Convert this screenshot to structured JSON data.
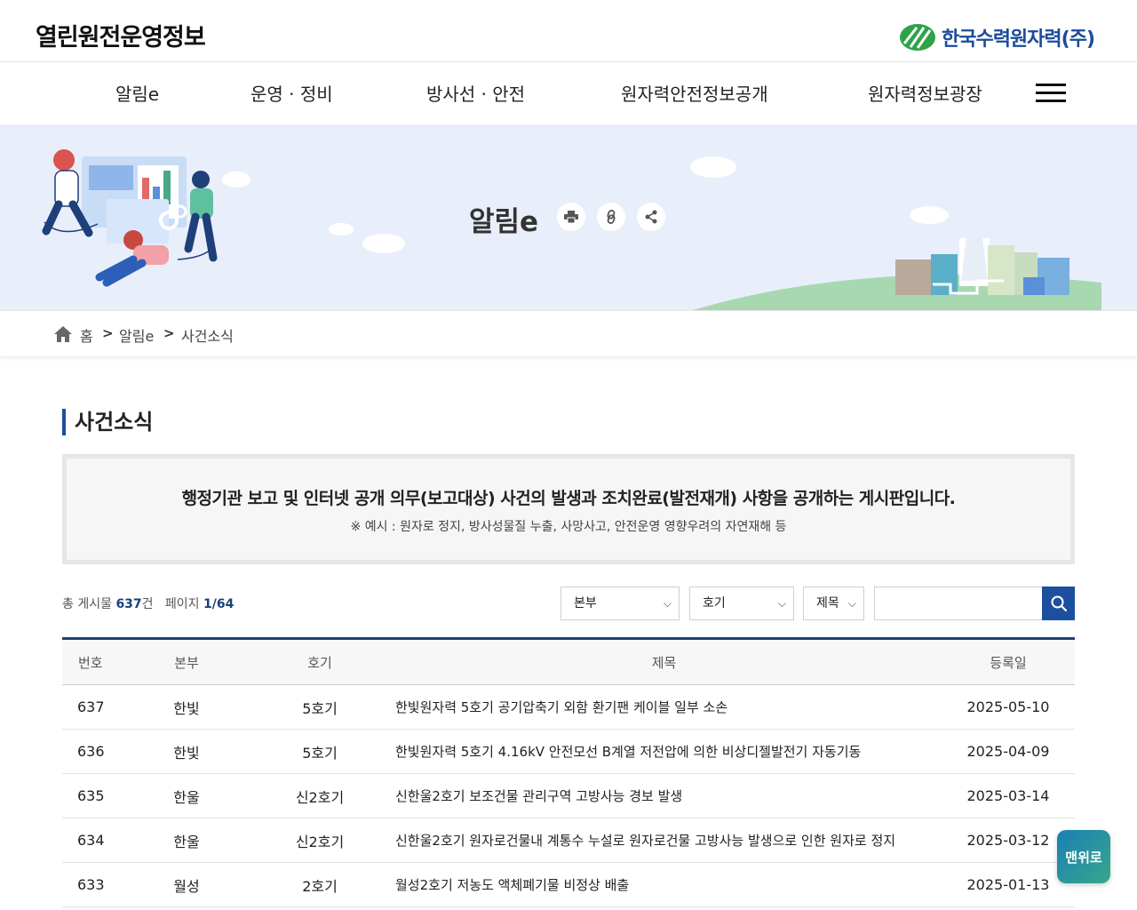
{
  "header": {
    "site_title": "열린원전운영정보",
    "logo_text": "한국수력원자력(주)"
  },
  "nav": {
    "items": [
      "알림e",
      "운영 · 정비",
      "방사선 · 안전",
      "원자력안전정보공개",
      "원자력정보광장"
    ],
    "menu_icon": "hamburger-menu-icon"
  },
  "banner": {
    "title": "알림e",
    "tools": [
      "print-icon",
      "link-icon",
      "share-icon"
    ]
  },
  "breadcrumb": {
    "items": [
      "홈",
      "알림e",
      "사건소식"
    ],
    "separator": ">"
  },
  "section": {
    "title": "사건소식"
  },
  "notice": {
    "main": "행정기관 보고 및 인터넷 공개 의무(보고대상) 사건의 발생과 조치완료(발전재개) 사항을 공개하는 게시판입니다.",
    "sub": "※ 예시 : 원자로 정지, 방사성물질 누출, 사망사고, 안전운영 영향우려의 자연재해 등"
  },
  "list_info": {
    "total_label": "총 게시물",
    "total": "637",
    "total_unit": "건",
    "page_label": "페이지",
    "page": "1/64"
  },
  "search": {
    "filter_hq": "본부",
    "filter_unit": "호기",
    "filter_field": "제목",
    "query": ""
  },
  "table": {
    "headers": [
      "번호",
      "본부",
      "호기",
      "제목",
      "등록일"
    ],
    "rows": [
      {
        "no": "637",
        "hq": "한빛",
        "unit": "5호기",
        "title": "한빛원자력 5호기 공기압축기 외함 환기팬 케이블 일부 소손",
        "date": "2025-05-10"
      },
      {
        "no": "636",
        "hq": "한빛",
        "unit": "5호기",
        "title": "한빛원자력 5호기 4.16kV 안전모선 B계열 저전압에 의한 비상디젤발전기 자동기동",
        "date": "2025-04-09"
      },
      {
        "no": "635",
        "hq": "한울",
        "unit": "신2호기",
        "title": "신한울2호기 보조건물 관리구역 고방사능 경보 발생",
        "date": "2025-03-14"
      },
      {
        "no": "634",
        "hq": "한울",
        "unit": "신2호기",
        "title": "신한울2호기 원자로건물내 계통수 누설로 원자로건물 고방사능 발생으로 인한 원자로 정지",
        "date": "2025-03-12"
      },
      {
        "no": "633",
        "hq": "월성",
        "unit": "2호기",
        "title": "월성2호기 저농도 액체폐기물 비정상 배출",
        "date": "2025-01-13"
      }
    ]
  },
  "to_top": "맨위로",
  "colors": {
    "primary": "#1c4fa0",
    "navy": "#1c3f7a",
    "banner_bg": "#e9eefb"
  }
}
